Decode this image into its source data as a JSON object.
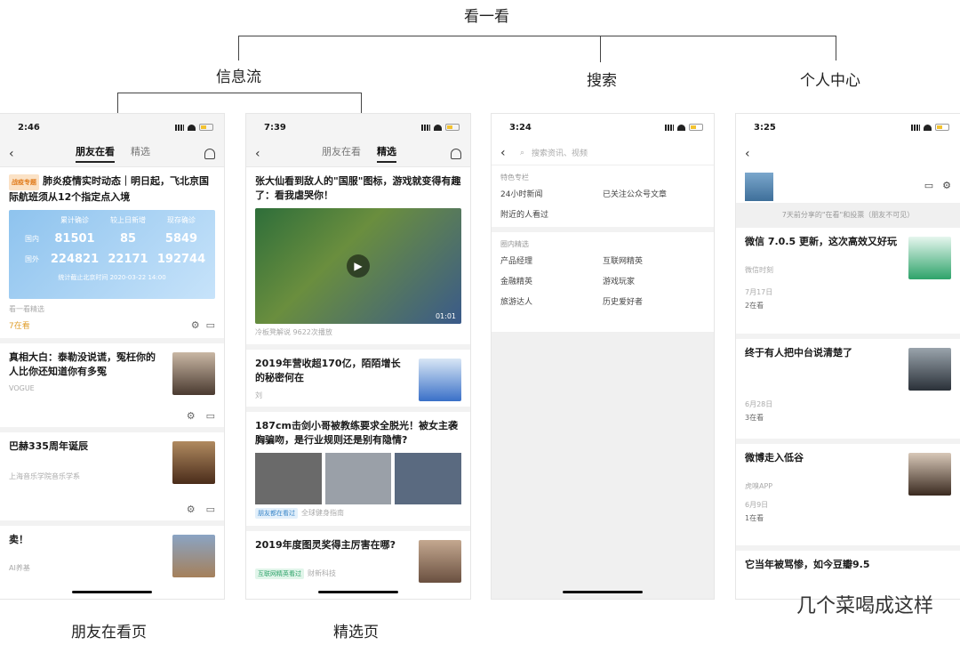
{
  "tree": {
    "root": "看一看",
    "branch_feed": "信息流",
    "branch_search": "搜索",
    "branch_profile": "个人中心"
  },
  "captions": {
    "friends": "朋友在看页",
    "selected": "精选页"
  },
  "phone1": {
    "time": "2:46",
    "tabs": [
      "朋友在看",
      "精选"
    ],
    "card1": {
      "tag": "战疫专题",
      "title": "肺炎疫情实时动态｜明日起，飞北京国际航班须从12个指定点入境",
      "headers": [
        "累计确诊",
        "较上日新增",
        "现存确诊"
      ],
      "rows": [
        {
          "label": "国内",
          "v": [
            "81501",
            "85",
            "5849"
          ]
        },
        {
          "label": "国外",
          "v": [
            "224821",
            "22171",
            "192744"
          ]
        }
      ],
      "foot": "统计截止北京时间 2020-03-22 14:00",
      "source": "看一看精选",
      "count": "7在看"
    },
    "card2": {
      "title": "真相大白：泰勒没说谎，冤枉你的人比你还知道你有多冤",
      "source": "VOGUE"
    },
    "card3": {
      "title": "巴赫335周年诞辰",
      "source": "上海音乐学院音乐学系"
    },
    "card4": {
      "title": "卖！",
      "source": "AI养基"
    }
  },
  "phone2": {
    "time": "7:39",
    "tabs": [
      "朋友在看",
      "精选"
    ],
    "card1": {
      "title": "张大仙看到敌人的\"国服\"图标，游戏就变得有趣了：看我虐哭你！",
      "duration": "01:01",
      "meta": "冷板凳解说  9622次播放"
    },
    "card2": {
      "title": "2019年营收超170亿，陌陌增长的秘密何在",
      "source": "刘"
    },
    "card3": {
      "title": "187cm击剑小哥被教练要求全脱光！被女主袭胸骗吻，是行业规则还是别有隐情?",
      "tag": "朋友都在看过",
      "source": "全球健身指南"
    },
    "card4": {
      "title": "2019年度图灵奖得主厉害在哪?",
      "tag": "互联网精英看过",
      "source": "财新科技"
    }
  },
  "phone3": {
    "time": "3:24",
    "placeholder": "搜索资讯、视频",
    "section1": "特色专栏",
    "section1_items": [
      "24小时新闻",
      "已关注公众号文章",
      "附近的人看过"
    ],
    "section2": "圈内精选",
    "section2_items": [
      "产品经理",
      "互联网精英",
      "金融精英",
      "游戏玩家",
      "旅游达人",
      "历史爱好者"
    ]
  },
  "phone4": {
    "time": "3:25",
    "note": "7天前分享的\"在看\"和投票（朋友不可见）",
    "items": [
      {
        "title": "微信 7.0.5 更新，这次高效又好玩",
        "source": "微信时刻",
        "date": "7月17日",
        "count": "2在看"
      },
      {
        "title": "终于有人把中台说清楚了",
        "source": "",
        "date": "6月28日",
        "count": "3在看"
      },
      {
        "title": "微博走入低谷",
        "source": "虎嗅APP",
        "date": "6月9日",
        "count": "1在看"
      },
      {
        "title": "它当年被骂惨，如今豆瓣9.5",
        "source": "",
        "date": "",
        "count": ""
      }
    ]
  },
  "watermark": "几个菜喝成这样"
}
